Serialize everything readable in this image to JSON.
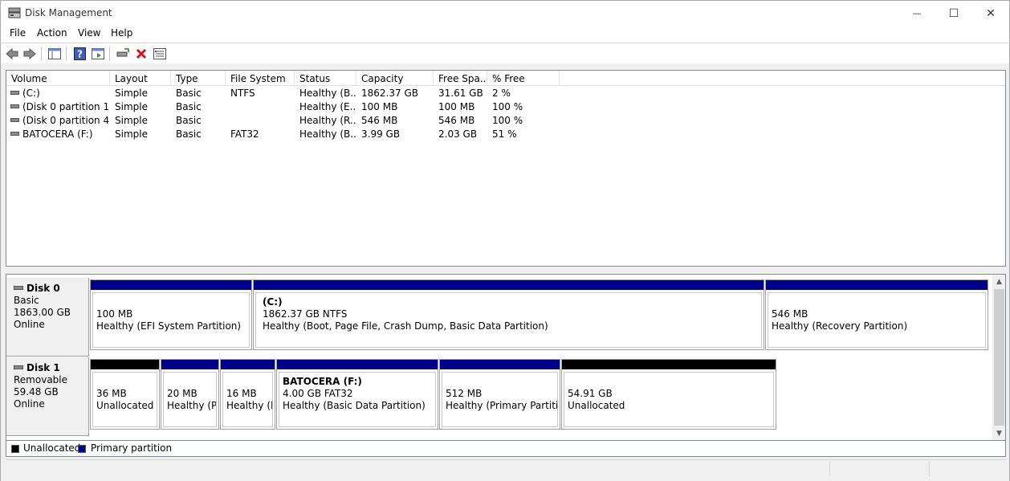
{
  "window": {
    "title": "Disk Management",
    "icon": "disk-management-icon",
    "controls": {
      "minimize": "—",
      "maximize": "☐",
      "close": "✕"
    }
  },
  "menu": [
    "File",
    "Action",
    "View",
    "Help"
  ],
  "toolbar": [
    "back-icon",
    "forward-icon",
    "show-hide-console-tree-icon",
    "help-icon",
    "properties-icon",
    "connect-virtual-disk-icon",
    "delete-icon",
    "settings-icon"
  ],
  "volume_list": {
    "columns": [
      "Volume",
      "Layout",
      "Type",
      "File System",
      "Status",
      "Capacity",
      "Free Spa...",
      "% Free"
    ],
    "rows": [
      [
        "(C:)",
        "Simple",
        "Basic",
        "NTFS",
        "Healthy (B...",
        "1862.37 GB",
        "31.61 GB",
        "2 %"
      ],
      [
        "(Disk 0 partition 1)",
        "Simple",
        "Basic",
        "",
        "Healthy (E...",
        "100 MB",
        "100 MB",
        "100 %"
      ],
      [
        "(Disk 0 partition 4)",
        "Simple",
        "Basic",
        "",
        "Healthy (R...",
        "546 MB",
        "546 MB",
        "100 %"
      ],
      [
        "BATOCERA (F:)",
        "Simple",
        "Basic",
        "FAT32",
        "Healthy (B...",
        "3.99 GB",
        "2.03 GB",
        "51 %"
      ]
    ]
  },
  "disks": [
    {
      "name": "Disk 0",
      "type": "Basic",
      "size": "1863.00 GB",
      "state": "Online",
      "partitions": [
        {
          "name": "",
          "size": "100 MB",
          "status": "Healthy (EFI System Partition)",
          "kind": "primary"
        },
        {
          "name": "(C:)",
          "size": "1862.37 GB NTFS",
          "status": "Healthy (Boot, Page File, Crash Dump, Basic Data Partition)",
          "kind": "primary"
        },
        {
          "name": "",
          "size": "546 MB",
          "status": "Healthy (Recovery Partition)",
          "kind": "primary"
        }
      ]
    },
    {
      "name": "Disk 1",
      "type": "Removable",
      "size": "59.48 GB",
      "state": "Online",
      "partitions": [
        {
          "name": "",
          "size": "36 MB",
          "status": "Unallocated",
          "kind": "unallocated"
        },
        {
          "name": "",
          "size": "20 MB",
          "status": "Healthy (Pr",
          "kind": "primary"
        },
        {
          "name": "",
          "size": "16 MB",
          "status": "Healthy (P",
          "kind": "primary"
        },
        {
          "name": "BATOCERA  (F:)",
          "size": "4.00 GB FAT32",
          "status": "Healthy (Basic Data Partition)",
          "kind": "primary"
        },
        {
          "name": "",
          "size": "512 MB",
          "status": "Healthy (Primary Partition",
          "kind": "primary"
        },
        {
          "name": "",
          "size": "54.91 GB",
          "status": "Unallocated",
          "kind": "unallocated"
        }
      ]
    }
  ],
  "legend": [
    {
      "label": "Unallocated",
      "color": "#000000"
    },
    {
      "label": "Primary partition",
      "color": "#00008b"
    }
  ]
}
